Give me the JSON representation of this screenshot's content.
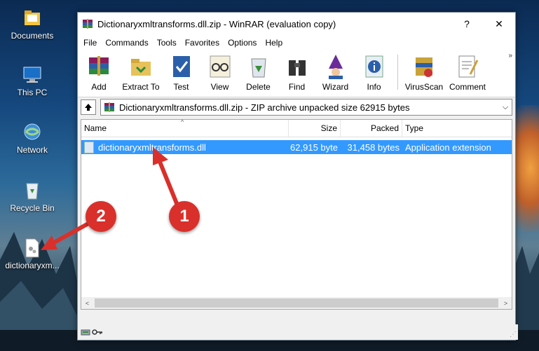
{
  "desktop": {
    "icons": [
      {
        "label": "Documents",
        "icon": "documents-folder-icon"
      },
      {
        "label": "This PC",
        "icon": "computer-icon"
      },
      {
        "label": "Network",
        "icon": "network-globe-icon"
      },
      {
        "label": "Recycle Bin",
        "icon": "recycle-bin-icon"
      },
      {
        "label": "dictionaryxm...",
        "icon": "dll-file-icon"
      }
    ]
  },
  "window": {
    "title": "Dictionaryxmltransforms.dll.zip - WinRAR (evaluation copy)",
    "help_btn": "?",
    "close_btn": "✕"
  },
  "menu": [
    "File",
    "Commands",
    "Tools",
    "Favorites",
    "Options",
    "Help"
  ],
  "toolbar": [
    {
      "label": "Add",
      "icon": "add-books-icon"
    },
    {
      "label": "Extract To",
      "icon": "extract-folder-icon"
    },
    {
      "label": "Test",
      "icon": "test-check-icon"
    },
    {
      "label": "View",
      "icon": "view-glasses-icon"
    },
    {
      "label": "Delete",
      "icon": "delete-recycle-icon"
    },
    {
      "label": "Find",
      "icon": "find-binoculars-icon"
    },
    {
      "label": "Wizard",
      "icon": "wizard-icon"
    },
    {
      "label": "Info",
      "icon": "info-icon"
    },
    {
      "label": "VirusScan",
      "icon": "virusscan-icon"
    },
    {
      "label": "Comment",
      "icon": "comment-icon"
    }
  ],
  "toolbar_more": "»",
  "address": {
    "text": "Dictionaryxmltransforms.dll.zip - ZIP archive unpacked size 62915 bytes",
    "dropdown": "⌵"
  },
  "columns": {
    "name": "Name",
    "size": "Size",
    "packed": "Packed",
    "type": "Type",
    "sort_indicator": "^"
  },
  "files": [
    {
      "name": "dictionaryxmltransforms.dll",
      "size": "62,915 byte",
      "packed": "31,458 bytes",
      "type": "Application extension"
    }
  ],
  "scroll": {
    "left": "<",
    "right": ">"
  },
  "annotations": {
    "badge1": "1",
    "badge2": "2",
    "color": "#d9302b"
  }
}
